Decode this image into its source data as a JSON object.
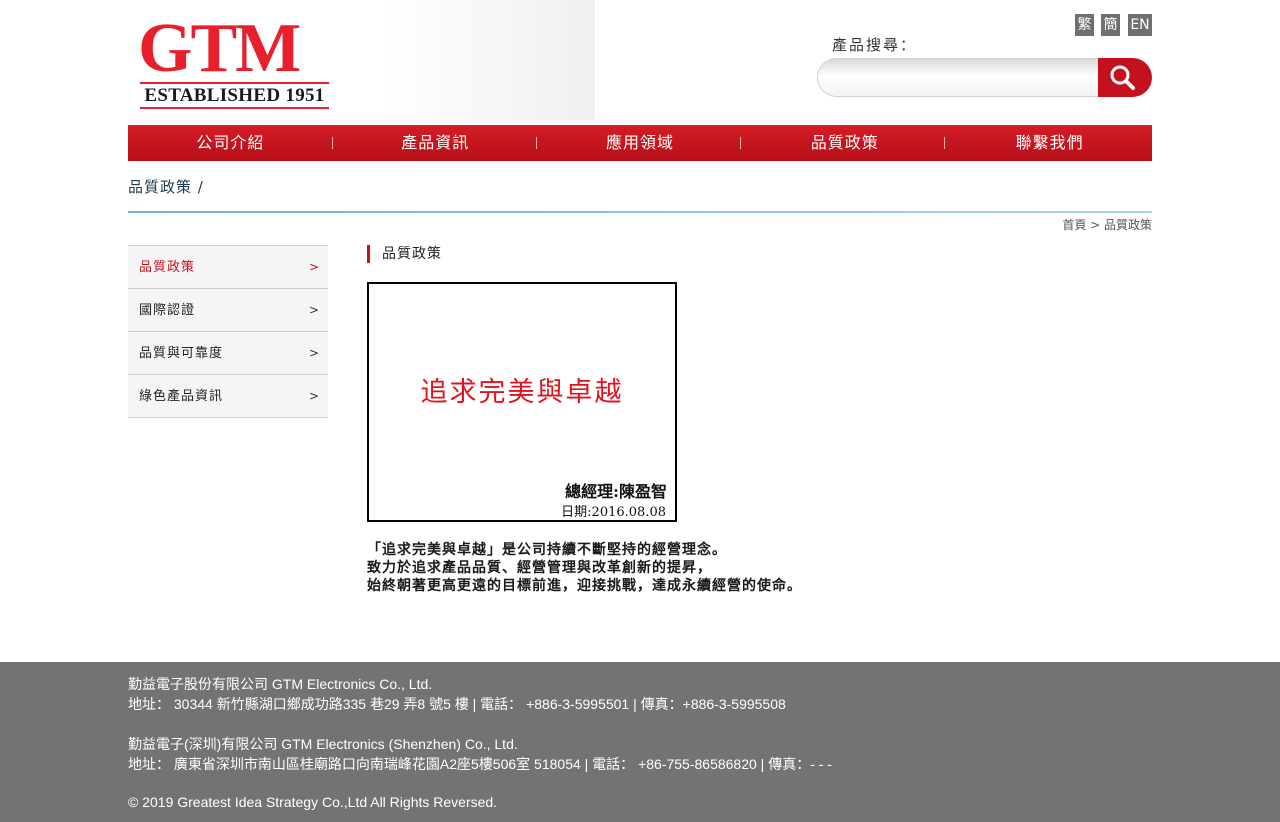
{
  "header": {
    "logo_text": "GTM",
    "logo_subtitle": "ESTABLISHED 1951",
    "languages": [
      "繁",
      "簡",
      "EN"
    ],
    "search_label": "產品搜尋：",
    "search_placeholder": ""
  },
  "nav": {
    "items": [
      "公司介紹",
      "產品資訊",
      "應用領域",
      "品質政策",
      "聯繫我們"
    ]
  },
  "page": {
    "title": "品質政策 /",
    "breadcrumb": "首頁 > 品質政策"
  },
  "sidebar": {
    "items": [
      {
        "label": "品質政策",
        "active": true
      },
      {
        "label": "國際認證",
        "active": false
      },
      {
        "label": "品質與可靠度",
        "active": false
      },
      {
        "label": "綠色產品資訊",
        "active": false
      }
    ],
    "arrow": ">"
  },
  "content": {
    "heading": "品質政策",
    "card_slogan": "追求完美與卓越",
    "card_signature": "總經理:陳盈智",
    "card_date": "日期:2016.08.08",
    "paragraph": [
      "「追求完美與卓越」是公司持續不斷堅持的經營理念。",
      "致力於追求產品品質、經營管理與改革創新的提昇，",
      "始終朝著更高更遠的目標前進，迎接挑戰，達成永續經營的使命。"
    ]
  },
  "footer": {
    "lines": [
      "勤益電子股份有限公司 GTM Electronics Co., Ltd.",
      "地址： 30344 新竹縣湖口鄉成功路335 巷29 弄8 號5 樓 | 電話： +886-3-5995501 | 傳真：+886-3-5995508",
      "勤益電子(深圳)有限公司 GTM Electronics (Shenzhen) Co., Ltd.",
      "地址： 廣東省深圳市南山區桂廟路口向南瑞峰花園A2座5樓506室 518054 | 電話： +86-755-86586820 | 傳真：- - -",
      "© 2019 Greatest Idea Strategy Co.,Ltd All Rights Reversed."
    ]
  },
  "colors": {
    "brand_red": "#c3121e",
    "footer_gray": "#737373",
    "rule_blue": "#6fb4d3"
  }
}
